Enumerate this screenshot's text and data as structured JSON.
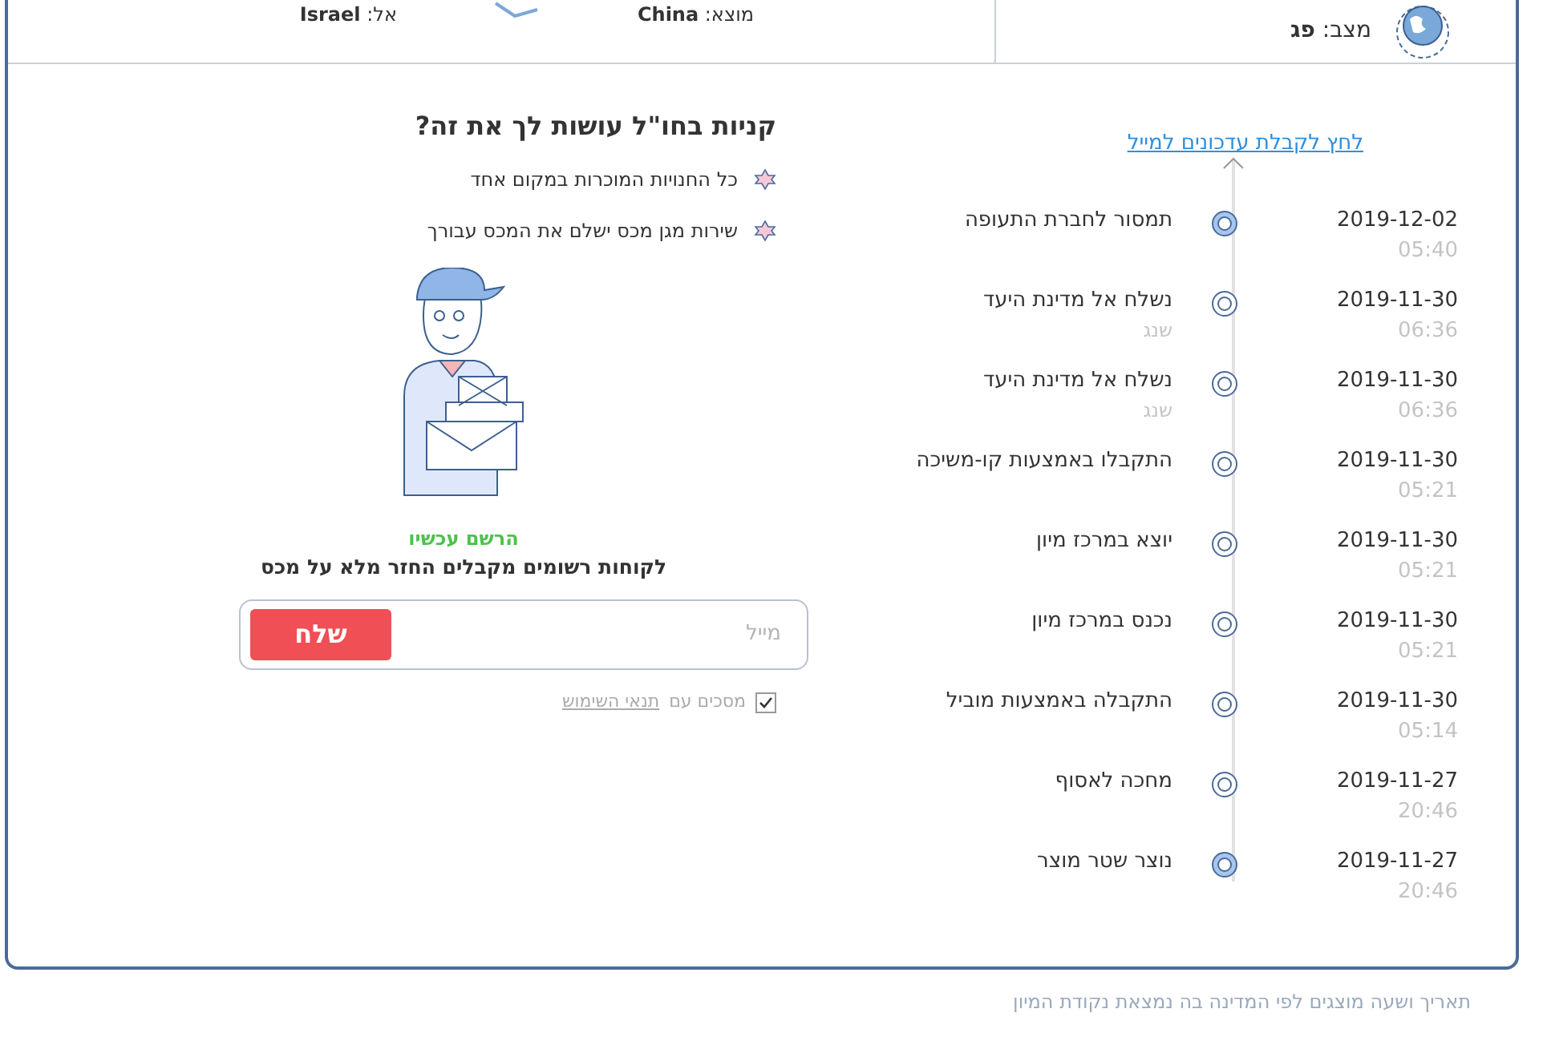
{
  "header": {
    "status_label": "מצב:",
    "status_value": "פג",
    "origin_label": "מוצא:",
    "origin_value": "China",
    "destination_label": "אל:",
    "destination_value": "Israel"
  },
  "timeline": {
    "subscribe_link": "לחץ לקבלת עדכונים למייל",
    "events": [
      {
        "date": "2019-12-02",
        "time": "05:40",
        "text": "תמסור לחברת התעופה",
        "highlighted": true
      },
      {
        "date": "2019-11-30",
        "time": "06:36",
        "text": "נשלח אל מדינת היעד",
        "place": "שנג",
        "highlighted": false
      },
      {
        "date": "2019-11-30",
        "time": "06:36",
        "text": "נשלח אל מדינת היעד",
        "place": "שנג",
        "highlighted": false
      },
      {
        "date": "2019-11-30",
        "time": "05:21",
        "text": "התקבלו באמצעות קו-משיכה",
        "highlighted": false
      },
      {
        "date": "2019-11-30",
        "time": "05:21",
        "text": "יוצא במרכז מיון",
        "highlighted": false
      },
      {
        "date": "2019-11-30",
        "time": "05:21",
        "text": "נכנס במרכז מיון",
        "highlighted": false
      },
      {
        "date": "2019-11-30",
        "time": "05:14",
        "text": "התקבלה באמצעות מוביל",
        "highlighted": false
      },
      {
        "date": "2019-11-27",
        "time": "20:46",
        "text": "מחכה לאסוף",
        "highlighted": false
      },
      {
        "date": "2019-11-27",
        "time": "20:46",
        "text": "נוצר שטר מוצר",
        "highlighted": true
      }
    ]
  },
  "promo": {
    "title": "קניות בחו\"ל עושות לך את זה?",
    "bullets": [
      "כל החנויות המוכרות במקום אחד",
      "שירות מגן מכס ישלם את המכס עבורך"
    ],
    "cta": "הרשם עכשיו",
    "subtitle": "לקוחות רשומים מקבלים החזר מלא על מכס",
    "email": {
      "placeholder": "מייל"
    },
    "send_button": "שלח",
    "terms": {
      "checked": true,
      "text": "מסכים עם",
      "link": "תנאי השימוש"
    }
  },
  "footnote": "תאריך ושעה מוצגים לפי המדינה בה נמצאת נקודת המיון"
}
